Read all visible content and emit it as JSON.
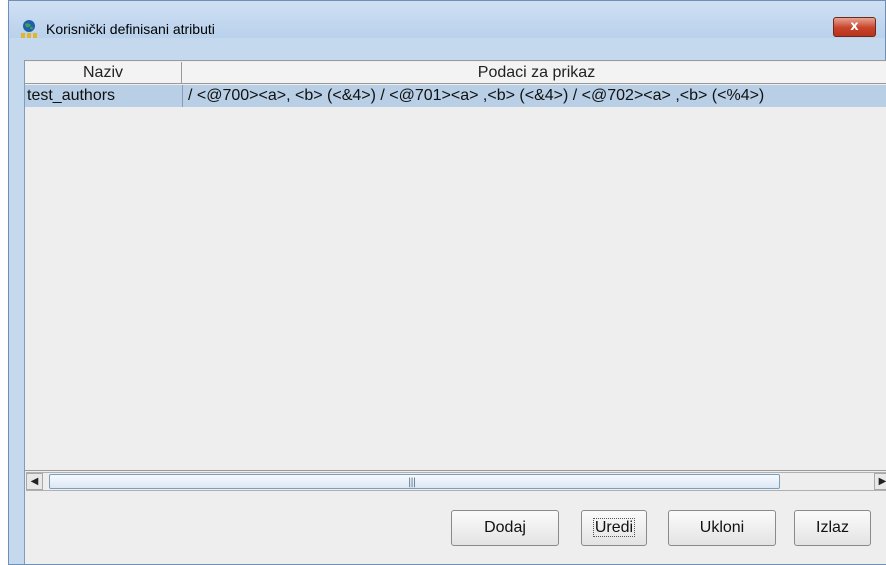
{
  "window": {
    "title": "Korisnički definisani atributi",
    "close_label": "x"
  },
  "table": {
    "columns": [
      "Naziv",
      "Podaci za prikaz"
    ],
    "rows": [
      {
        "naziv": "test_authors",
        "podaci": "/ <@700><a>, <b> (<&4>) / <@701><a> ,<b> (<&4>) / <@702><a> ,<b> (<%4>)"
      }
    ],
    "selected_row": 0
  },
  "scrollbar": {
    "left_arrow": "◀",
    "right_arrow": "▶",
    "grip": "|||"
  },
  "buttons": {
    "dodaj": "Dodaj",
    "uredi": "Uredi",
    "ukloni": "Ukloni",
    "izlaz": "Izlaz"
  },
  "colors": {
    "selected_row": "#b8cfe5",
    "title_bar": "#c4d8ee",
    "close_button": "#c7432a"
  }
}
